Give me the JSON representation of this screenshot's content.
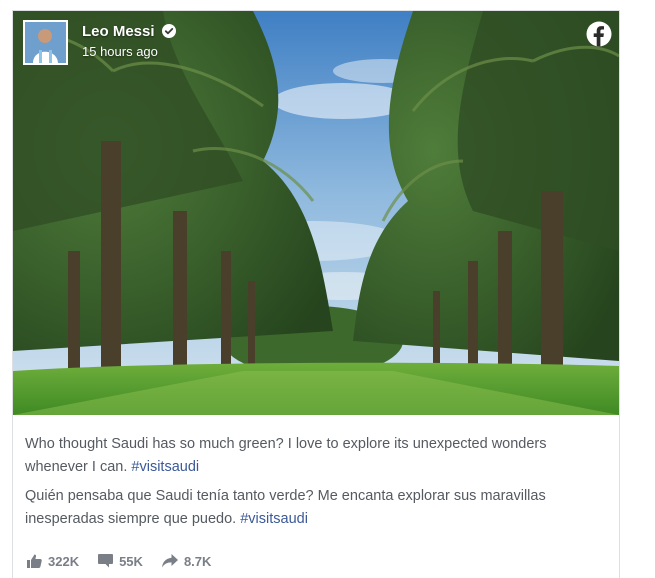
{
  "post": {
    "author": "Leo Messi",
    "timestamp": "15 hours ago",
    "caption_en_text": "Who thought Saudi has so much green? I love to explore its unexpected wonders whenever I can.",
    "caption_en_hashtag": "#visitsaudi",
    "caption_es_text": "Quién pensaba que Saudi tenía tanto verde? Me encanta explorar sus maravillas inesperadas siempre que puedo.",
    "caption_es_hashtag": "#visitsaudi"
  },
  "stats": {
    "likes": "322K",
    "comments": "55K",
    "shares": "8.7K"
  },
  "icons": {
    "verified": "verified-badge-icon",
    "platform": "facebook-logo-icon",
    "likes": "thumbs-up-icon",
    "comments": "comment-bubble-icon",
    "shares": "share-arrow-icon"
  },
  "colors": {
    "hashtag": "#3b5998",
    "text": "#555a61",
    "stats": "#7a7f87",
    "border": "#dddfe2"
  }
}
